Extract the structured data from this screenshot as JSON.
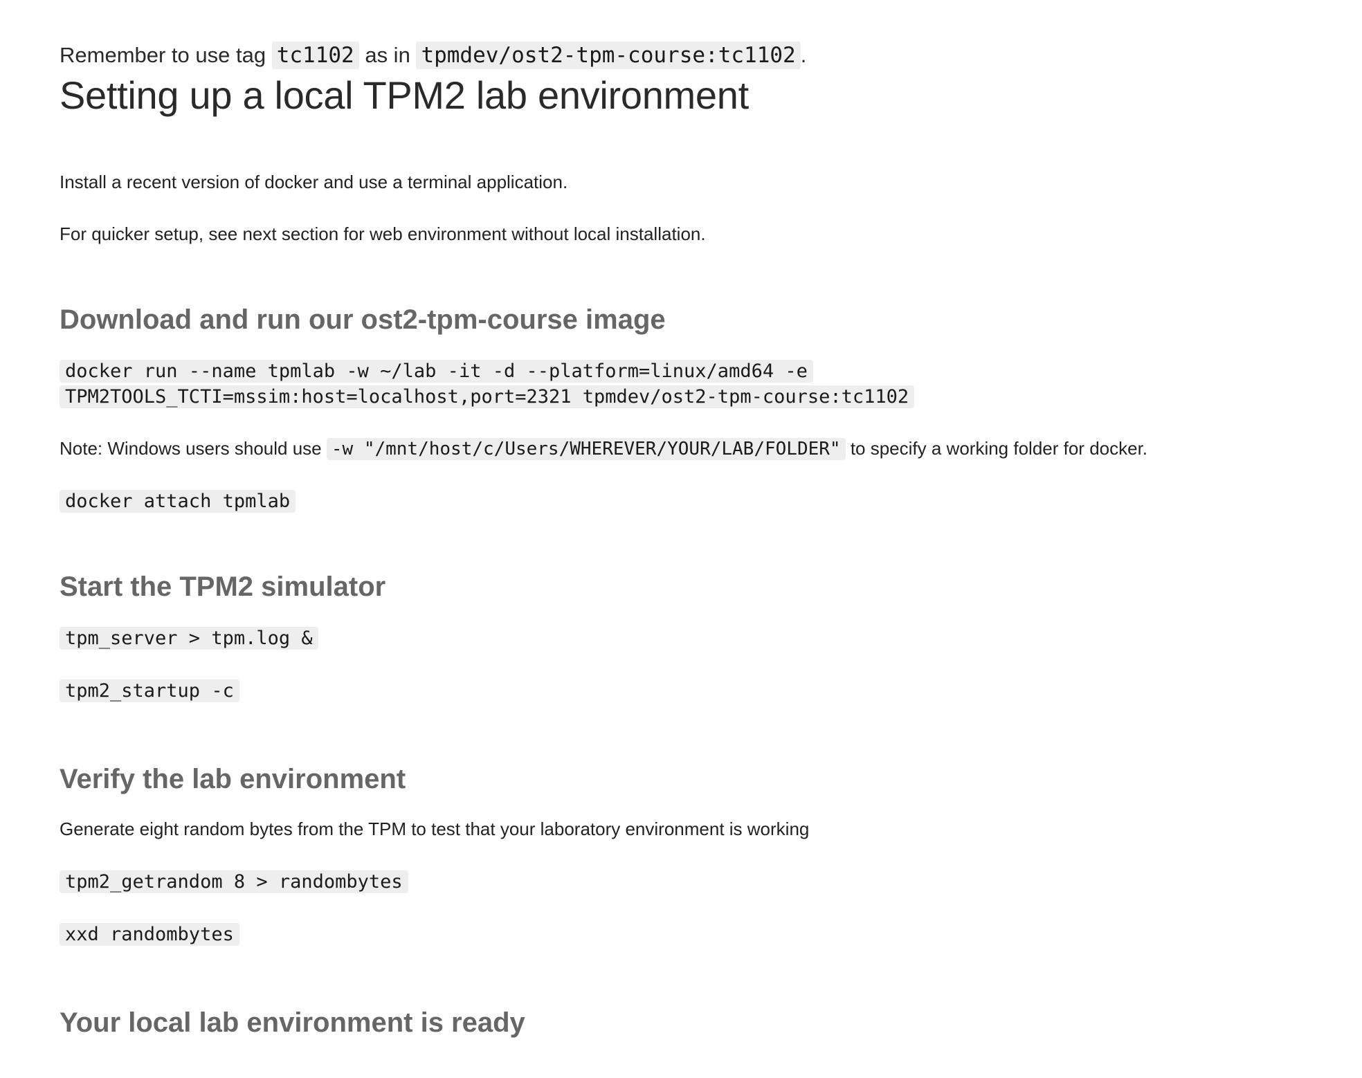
{
  "intro": {
    "prefix": "Remember to use tag",
    "tag": "tc1102",
    "middle": "as in",
    "image_ref": "tpmdev/ost2-tpm-course:tc1102",
    "suffix": "."
  },
  "page_title": "Setting up a local TPM2 lab environment",
  "install_text": "Install a recent version of docker and use a terminal application.",
  "quicker_text": "For quicker setup, see next section for web environment without local installation.",
  "sections": {
    "download": {
      "heading": "Download and run our ost2-tpm-course image",
      "run_command": "docker run --name tpmlab -w ~/lab -it -d --platform=linux/amd64 -e TPM2TOOLS_TCTI=mssim:host=localhost,port=2321 tpmdev/ost2-tpm-course:tc1102",
      "note_prefix": "Note: Windows users should use",
      "note_code": "-w \"/mnt/host/c/Users/WHEREVER/YOUR/LAB/FOLDER\"",
      "note_suffix": "to specify a working folder for docker.",
      "attach_command": "docker attach tpmlab"
    },
    "simulator": {
      "heading": "Start the TPM2 simulator",
      "server_command": "tpm_server > tpm.log &",
      "startup_command": "tpm2_startup -c"
    },
    "verify": {
      "heading": "Verify the lab environment",
      "description": "Generate eight random bytes from the TPM to test that your laboratory environment is working",
      "getrandom_command": "tpm2_getrandom 8 > randombytes",
      "xxd_command": "xxd randombytes"
    },
    "ready": {
      "heading": "Your local lab environment is ready"
    }
  }
}
